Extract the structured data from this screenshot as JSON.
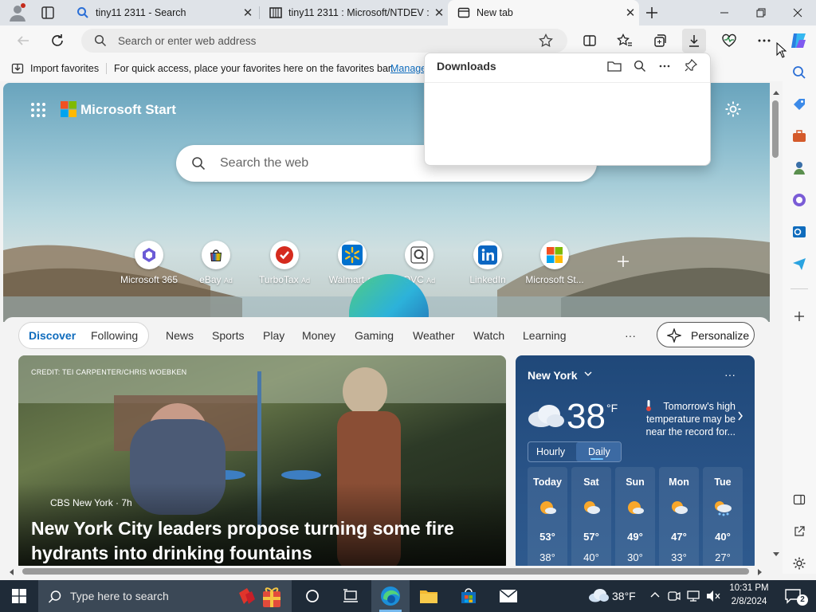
{
  "tabs": [
    {
      "title": "tiny11 2311 - Search",
      "active": false,
      "icon": "search-icon"
    },
    {
      "title": "tiny11 2311 : Microsoft/NTDEV :",
      "active": false,
      "icon": "archive-icon"
    },
    {
      "title": "New tab",
      "active": true,
      "icon": "newtab-icon"
    }
  ],
  "address": {
    "placeholder": "Search or enter web address"
  },
  "favorites": {
    "import_label": "Import favorites",
    "hint": "For quick access, place your favorites here on the favorites bar.",
    "manage_label": "Manage"
  },
  "downloads": {
    "title": "Downloads"
  },
  "brand": {
    "name": "Microsoft Start"
  },
  "search": {
    "placeholder": "Search the web"
  },
  "shortcuts": [
    {
      "label": "Microsoft 365",
      "ad": "",
      "icon": "m365-icon"
    },
    {
      "label": "eBay",
      "ad": "Ad",
      "icon": "ebay-icon"
    },
    {
      "label": "TurboTax",
      "ad": "Ad",
      "icon": "turbotax-icon"
    },
    {
      "label": "Walmart",
      "ad": "Ad",
      "icon": "walmart-icon"
    },
    {
      "label": "QVC",
      "ad": "Ad",
      "icon": "qvc-icon"
    },
    {
      "label": "LinkedIn",
      "ad": "",
      "icon": "linkedin-icon"
    },
    {
      "label": "Microsoft St...",
      "ad": "",
      "icon": "msstore-icon"
    }
  ],
  "feed_nav": {
    "items": [
      "Discover",
      "Following",
      "News",
      "Sports",
      "Play",
      "Money",
      "Gaming",
      "Weather",
      "Watch",
      "Learning"
    ],
    "active": "Discover",
    "more": "···",
    "personalize": "Personalize"
  },
  "article": {
    "credit": "CREDIT: TEI CARPENTER/CHRIS WOEBKEN",
    "source": "CBS New York · 7h",
    "headline": "New York City leaders propose turning some fire hydrants into drinking fountains"
  },
  "weather": {
    "location": "New York",
    "temp": "38",
    "unit": "°F",
    "note": "Tomorrow's high temperature may be near the record for...",
    "tabs": [
      "Hourly",
      "Daily"
    ],
    "active_tab": "Daily",
    "days": [
      {
        "name": "Today",
        "hi": "53°",
        "lo": "38°",
        "icon": "partly-sunny-icon"
      },
      {
        "name": "Sat",
        "hi": "57°",
        "lo": "40°",
        "icon": "partly-cloudy-icon"
      },
      {
        "name": "Sun",
        "hi": "49°",
        "lo": "30°",
        "icon": "partly-sunny-icon"
      },
      {
        "name": "Mon",
        "hi": "47°",
        "lo": "33°",
        "icon": "partly-cloudy-icon"
      },
      {
        "name": "Tue",
        "hi": "40°",
        "lo": "27°",
        "icon": "snow-icon"
      }
    ]
  },
  "taskbar": {
    "search_placeholder": "Type here to search",
    "weather": "38°F",
    "time": "10:31 PM",
    "date": "2/8/2024",
    "notifications": "2"
  },
  "colors": {
    "accent": "#0f6cbd",
    "taskbar": "#1f2b38",
    "weather_card": "#1f4879"
  }
}
